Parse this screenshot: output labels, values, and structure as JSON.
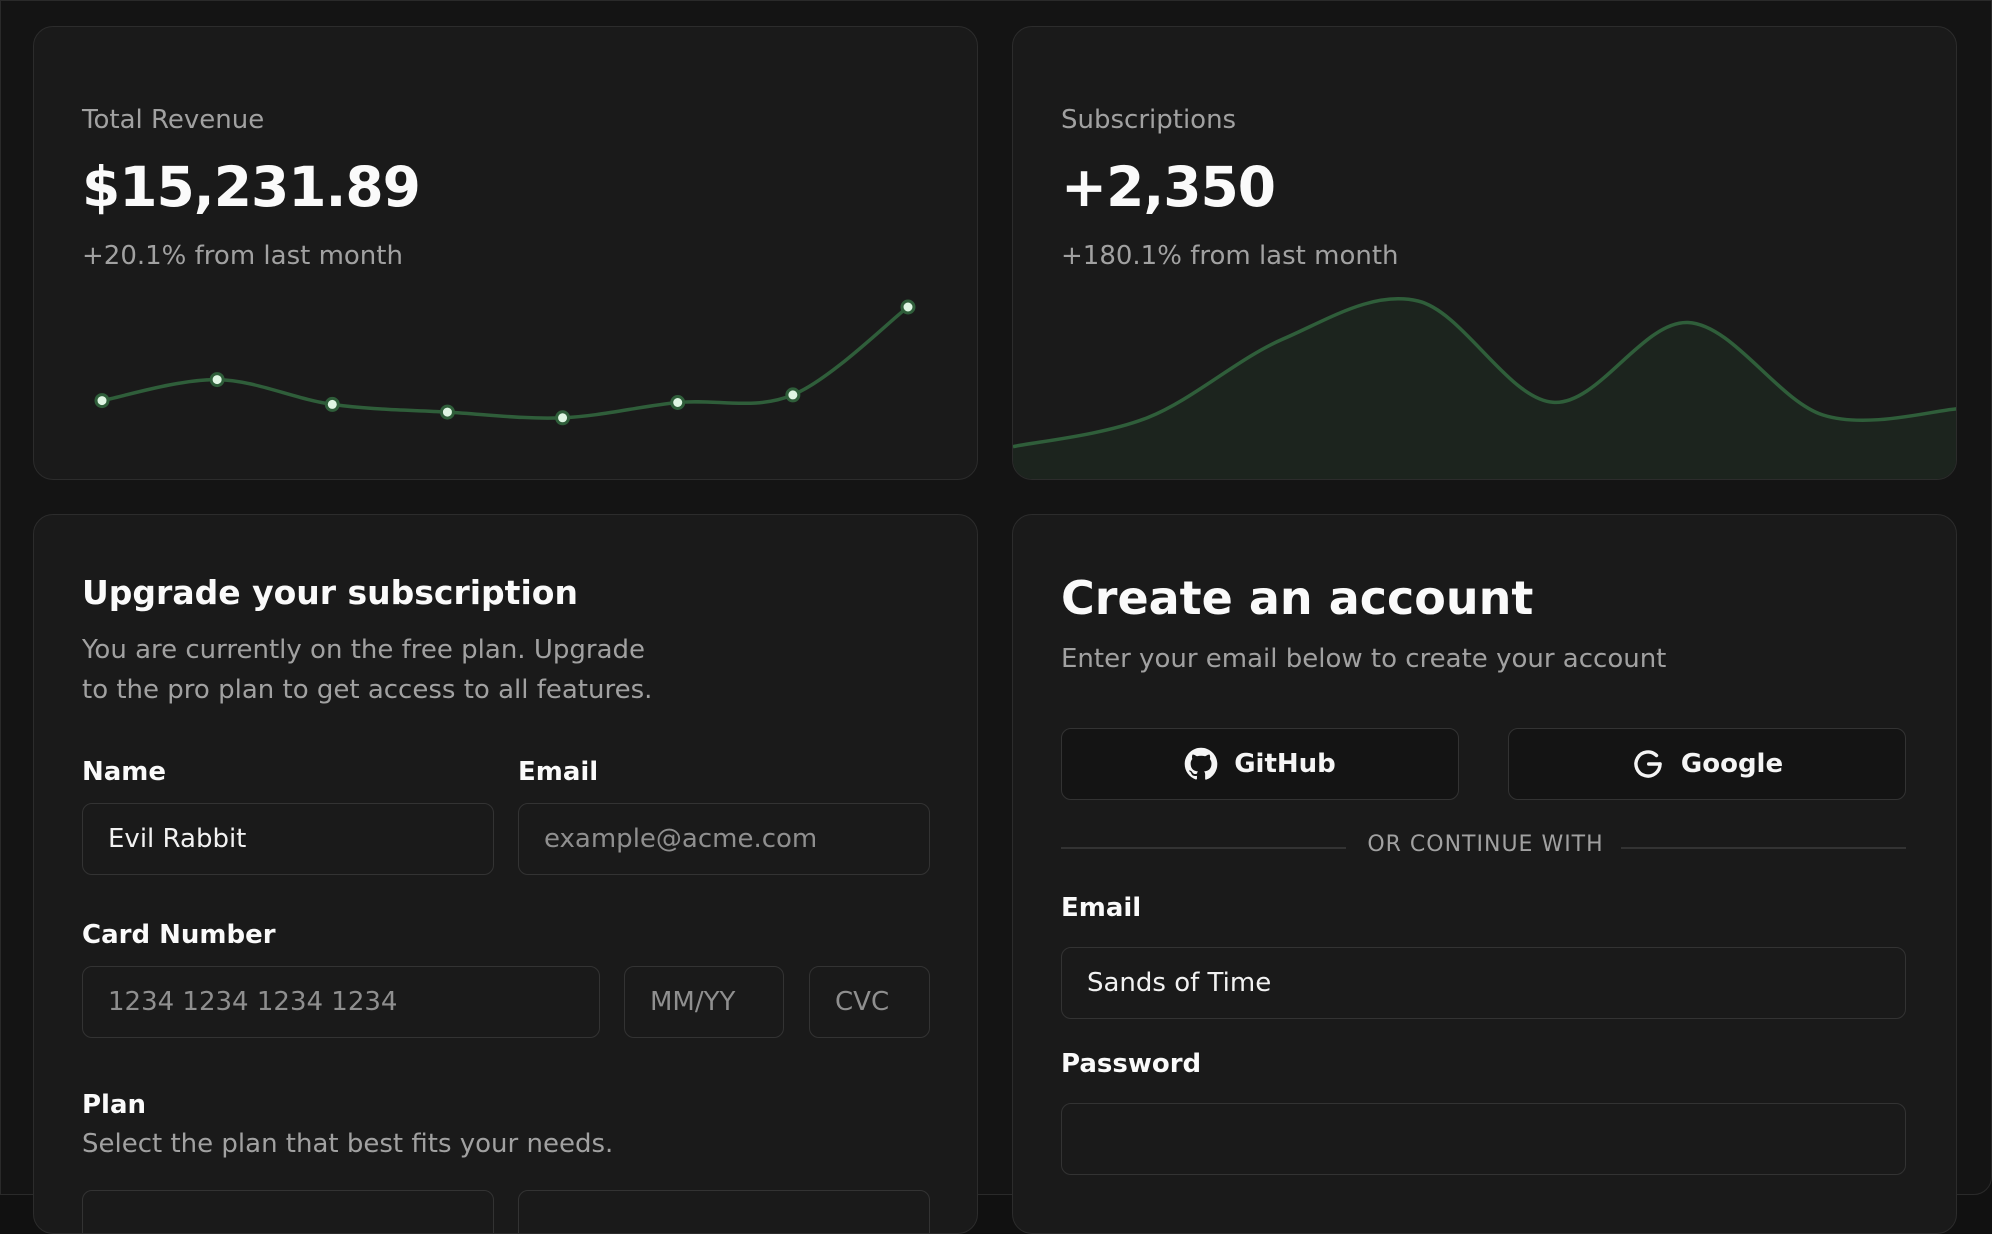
{
  "revenue": {
    "label": "Total Revenue",
    "value": "$15,231.89",
    "delta": "+20.1% from last month"
  },
  "subscriptions": {
    "label": "Subscriptions",
    "value": "+2,350",
    "delta": "+180.1% from last month"
  },
  "upgrade": {
    "title": "Upgrade your subscription",
    "description_line1": "You are currently on the free plan. Upgrade",
    "description_line2": "to the pro plan to get access to all features.",
    "name_label": "Name",
    "name_value": "Evil Rabbit",
    "email_label": "Email",
    "email_placeholder": "example@acme.com",
    "card_label": "Card Number",
    "card_placeholder": "1234 1234 1234 1234",
    "expiry_placeholder": "MM/YY",
    "cvc_placeholder": "CVC",
    "plan_label": "Plan",
    "plan_description": "Select the plan that best fits your needs."
  },
  "account": {
    "title": "Create an account",
    "description": "Enter your email below to create your account",
    "github_label": "GitHub",
    "google_label": "Google",
    "divider": "OR CONTINUE WITH",
    "email_label": "Email",
    "email_value": "Sands of Time",
    "password_label": "Password",
    "password_value": ""
  },
  "colors": {
    "accent": "#2f5e3a",
    "dot_fill": "#dff5e3",
    "area_fill": "#1c241e"
  },
  "chart_data": [
    {
      "type": "line",
      "series": [
        {
          "values": [
            18,
            29,
            16,
            12,
            9,
            17,
            21,
            67
          ]
        }
      ]
    },
    {
      "type": "area",
      "series": [
        {
          "values": [
            5,
            28,
            90,
            120,
            40,
            103,
            30,
            35
          ]
        }
      ]
    }
  ]
}
